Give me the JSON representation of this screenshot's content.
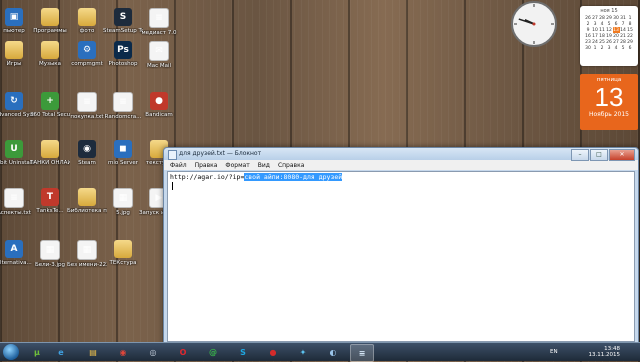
{
  "desktop_icons": [
    {
      "label": "пьютер",
      "kind": "app-blue",
      "glyph": "▣"
    },
    {
      "label": "Программы",
      "kind": "folder",
      "glyph": ""
    },
    {
      "label": "фото",
      "kind": "folder",
      "glyph": ""
    },
    {
      "label": "SteamSetup Test 2015",
      "kind": "app-dark",
      "glyph": "S"
    },
    {
      "label": "медиаст 7.0",
      "kind": "doc",
      "glyph": "≡"
    },
    {
      "label": "Игры",
      "kind": "folder",
      "glyph": ""
    },
    {
      "label": "Музыка",
      "kind": "folder",
      "glyph": ""
    },
    {
      "label": "compmgmt",
      "kind": "app-blue",
      "glyph": "⚙"
    },
    {
      "label": "Photoshop",
      "kind": "app-ps",
      "glyph": "Ps"
    },
    {
      "label": "Mac Mail",
      "kind": "doc",
      "glyph": "✉"
    },
    {
      "label": "Advanced SystemCare",
      "kind": "app-blue",
      "glyph": "↻"
    },
    {
      "label": "360 Total Security",
      "kind": "app-green",
      "glyph": "+"
    },
    {
      "label": "покупка.txt",
      "kind": "doc",
      "glyph": "≡"
    },
    {
      "label": "Randomcra...",
      "kind": "doc",
      "glyph": "≡"
    },
    {
      "label": "Bandicam",
      "kind": "app-red",
      "glyph": "●"
    },
    {
      "label": "IObit Uninstaller",
      "kind": "app-green",
      "glyph": "U"
    },
    {
      "label": "ТАНКИ ОНЛАЙН",
      "kind": "folder",
      "glyph": ""
    },
    {
      "label": "Steam",
      "kind": "app-dark",
      "glyph": "◉"
    },
    {
      "label": "mio Server",
      "kind": "app-blue",
      "glyph": "◼"
    },
    {
      "label": "текстура",
      "kind": "folder",
      "glyph": ""
    },
    {
      "label": "Аспекты.txt",
      "kind": "doc",
      "glyph": "≡"
    },
    {
      "label": "ТanksTe...",
      "kind": "app-red",
      "glyph": "T"
    },
    {
      "label": "Библиотека пропов",
      "kind": "folder",
      "glyph": ""
    },
    {
      "label": "5.jpg",
      "kind": "doc",
      "glyph": "▦"
    },
    {
      "label": "Запуск игры Бандит...",
      "kind": "doc",
      "glyph": "▶"
    },
    {
      "label": "Alternativa...",
      "kind": "app-blue",
      "glyph": "A"
    },
    {
      "label": "Бели-3.jpg",
      "kind": "doc",
      "glyph": "▦"
    },
    {
      "label": "Без имени-222...",
      "kind": "doc",
      "glyph": "▦"
    },
    {
      "label": "ТЕКстура",
      "kind": "folder",
      "glyph": ""
    }
  ],
  "clock": {
    "hour": 9,
    "minute": 48
  },
  "calendar": {
    "header": "ноя 15",
    "weeks": [
      [
        "26",
        "27",
        "28",
        "29",
        "30",
        "31",
        "1"
      ],
      [
        "2",
        "3",
        "4",
        "5",
        "6",
        "7",
        "8"
      ],
      [
        "9",
        "10",
        "11",
        "12",
        "13",
        "14",
        "15"
      ],
      [
        "16",
        "17",
        "18",
        "19",
        "20",
        "21",
        "22"
      ],
      [
        "23",
        "24",
        "25",
        "26",
        "27",
        "28",
        "29"
      ],
      [
        "30",
        "1",
        "2",
        "3",
        "4",
        "5",
        "6"
      ]
    ],
    "today": "13"
  },
  "bigdate": {
    "weekday": "пятница",
    "day": "13",
    "month_year": "Ноябрь 2015"
  },
  "notepad": {
    "title": "для друзей.txt — Блокнот",
    "menu": [
      "Файл",
      "Правка",
      "Формат",
      "Вид",
      "Справка"
    ],
    "text_plain": "http://agar.io/?ip=",
    "text_selected": "свой айпи:8080-для друзей",
    "btn_minimize": "–",
    "btn_maximize": "□",
    "btn_close": "✕"
  },
  "taskbar": {
    "apps": [
      {
        "name": "torrent-icon",
        "glyph": "µ",
        "color": "#6fbf3b",
        "active": false
      },
      {
        "name": "ie-icon",
        "glyph": "e",
        "color": "#3fa0e0",
        "active": false
      },
      {
        "name": "explorer-icon",
        "glyph": "▤",
        "color": "#f1c24a",
        "active": false
      },
      {
        "name": "chrome-icon",
        "glyph": "◉",
        "color": "#e0463a",
        "active": false
      },
      {
        "name": "steam-icon",
        "glyph": "◎",
        "color": "#c9d3df",
        "active": false
      },
      {
        "name": "opera-icon",
        "glyph": "O",
        "color": "#e0282e",
        "active": false
      },
      {
        "name": "mailru-agent-icon",
        "glyph": "@",
        "color": "#39b54a",
        "active": false
      },
      {
        "name": "skype-icon",
        "glyph": "S",
        "color": "#1ea8e3",
        "active": false
      },
      {
        "name": "bandicam-icon",
        "glyph": "●",
        "color": "#d32b2b",
        "active": false
      },
      {
        "name": "game-icon",
        "glyph": "✦",
        "color": "#5cc3f0",
        "active": false
      },
      {
        "name": "media-icon",
        "glyph": "◐",
        "color": "#9bc5ea",
        "active": false
      },
      {
        "name": "notepad-icon",
        "glyph": "≡",
        "color": "#d5e6f6",
        "active": true
      }
    ],
    "lang": "EN",
    "time": "13:48",
    "date": "13.11.2015"
  }
}
